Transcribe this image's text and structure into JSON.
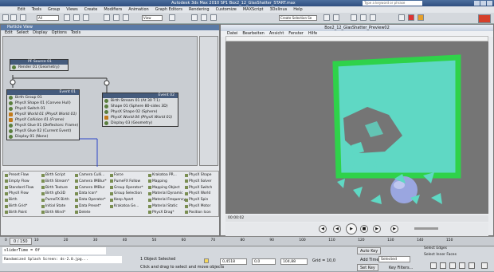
{
  "titlebar": {
    "title": "Autodesk 3ds Max 2010 SP1     Box2_12_GlasShatter_START.max",
    "search": "Type a keyword or phrase"
  },
  "menu": [
    "Edit",
    "Tools",
    "Group",
    "Views",
    "Create",
    "Modifiers",
    "Animation",
    "Graph Editors",
    "Rendering",
    "Customize",
    "MAXScript",
    "3Dxlinus",
    "Help"
  ],
  "toolbar": {
    "select_filter": "All",
    "viewport": "View",
    "selection_set": "Create Selection Se"
  },
  "particle_view": {
    "title": "Particle View",
    "menu": [
      "Edit",
      "Select",
      "Display",
      "Options",
      "Tools"
    ],
    "pf_source": {
      "header": "PF Source 01",
      "rows": [
        "Render 01 (Geometry)"
      ]
    },
    "event01": {
      "header": "Event 01",
      "rows": [
        "Birth Group 01",
        "PhysX Shape 01 (Convex Hull)",
        "PhysX Switch 01",
        "PhysX World 01 (PhysX World 01)",
        "PhysX Collision 01 (Frame)",
        "PhysX Glue 01 (Deflectors: Frame)",
        "PhysX Glue 02 (Current Event)",
        "Display 01 (None)"
      ]
    },
    "event02": {
      "header": "Event 02",
      "rows": [
        "Birth Stream 01 (At 30 T:1)",
        "Shape 01 (Sphere 80-sides 3D)",
        "PhysX Shape 02 (Sphere)",
        "PhysX World 06 (PhysX World 01)",
        "Display 03 (Geometry)"
      ]
    },
    "depot": [
      [
        "Preset Flow",
        "Empty Flow",
        "Standard Flow",
        "PhysX Flow",
        "Birth",
        "Birth Grid*",
        "Birth Paint"
      ],
      [
        "Birth Script",
        "Birth Stream*",
        "Birth Texture",
        "Birth gfx3D",
        "PumeFX Birth",
        "Initial State",
        "Birth Wind*"
      ],
      [
        "Camera Culli...",
        "Camera IMBlur*",
        "Camera IMBlur",
        "Data Icon*",
        "Data Operator*",
        "Data Preset*",
        "Delete"
      ],
      [
        "Force",
        "PumeFX Follow",
        "Group Operator*",
        "Group Selection",
        "Keep Apart",
        "Krakatoa Ge..."
      ],
      [
        "Krakatoa PR...",
        "Mapping",
        "Mapping Object",
        "Material Dynamic",
        "Material Frequency",
        "Material Static",
        "PhysX Drag*"
      ],
      [
        "PhysX Shape",
        "PhysX Solver",
        "PhysX Switch",
        "PhysX World",
        "PhysX Spin",
        "PhysX Motor",
        "Position Icon"
      ]
    ]
  },
  "preview": {
    "title": "Box2_12_GlasShatter_Preview02",
    "menu": [
      "Datei",
      "Bearbeiten",
      "Ansicht",
      "Fenster",
      "Hilfe"
    ],
    "time": "00:00:02"
  },
  "timeline": {
    "frame": "0 / 150",
    "ticks": [
      "0",
      "10",
      "20",
      "30",
      "40",
      "50",
      "60",
      "70",
      "80",
      "90",
      "100",
      "110",
      "120",
      "130",
      "140",
      "150"
    ]
  },
  "status": {
    "script_line1": "sliderTime = 0f",
    "script_line2": "Randomized Splash Screen: ds-2.0.jpg...",
    "selected": "1 Object Selected",
    "prompt": "Click and drag to select and move objects",
    "x": "0,4518",
    "y": "0,0",
    "z": "104,88",
    "grid": "Grid = 10,0",
    "auto_key": "Auto Key",
    "set_key": "Set Key",
    "selected_mode": "Selected",
    "key_filters": "Key Filters...",
    "add_time_tag": "Add Time Tag",
    "select_edges": "Select Edges",
    "select_inner_faces": "Select Inner Faces"
  },
  "colors": {
    "glass": "#5fd8c4",
    "frame": "#2fd24a",
    "ball": "#9aa6e0",
    "scene_bg": "#757575"
  }
}
